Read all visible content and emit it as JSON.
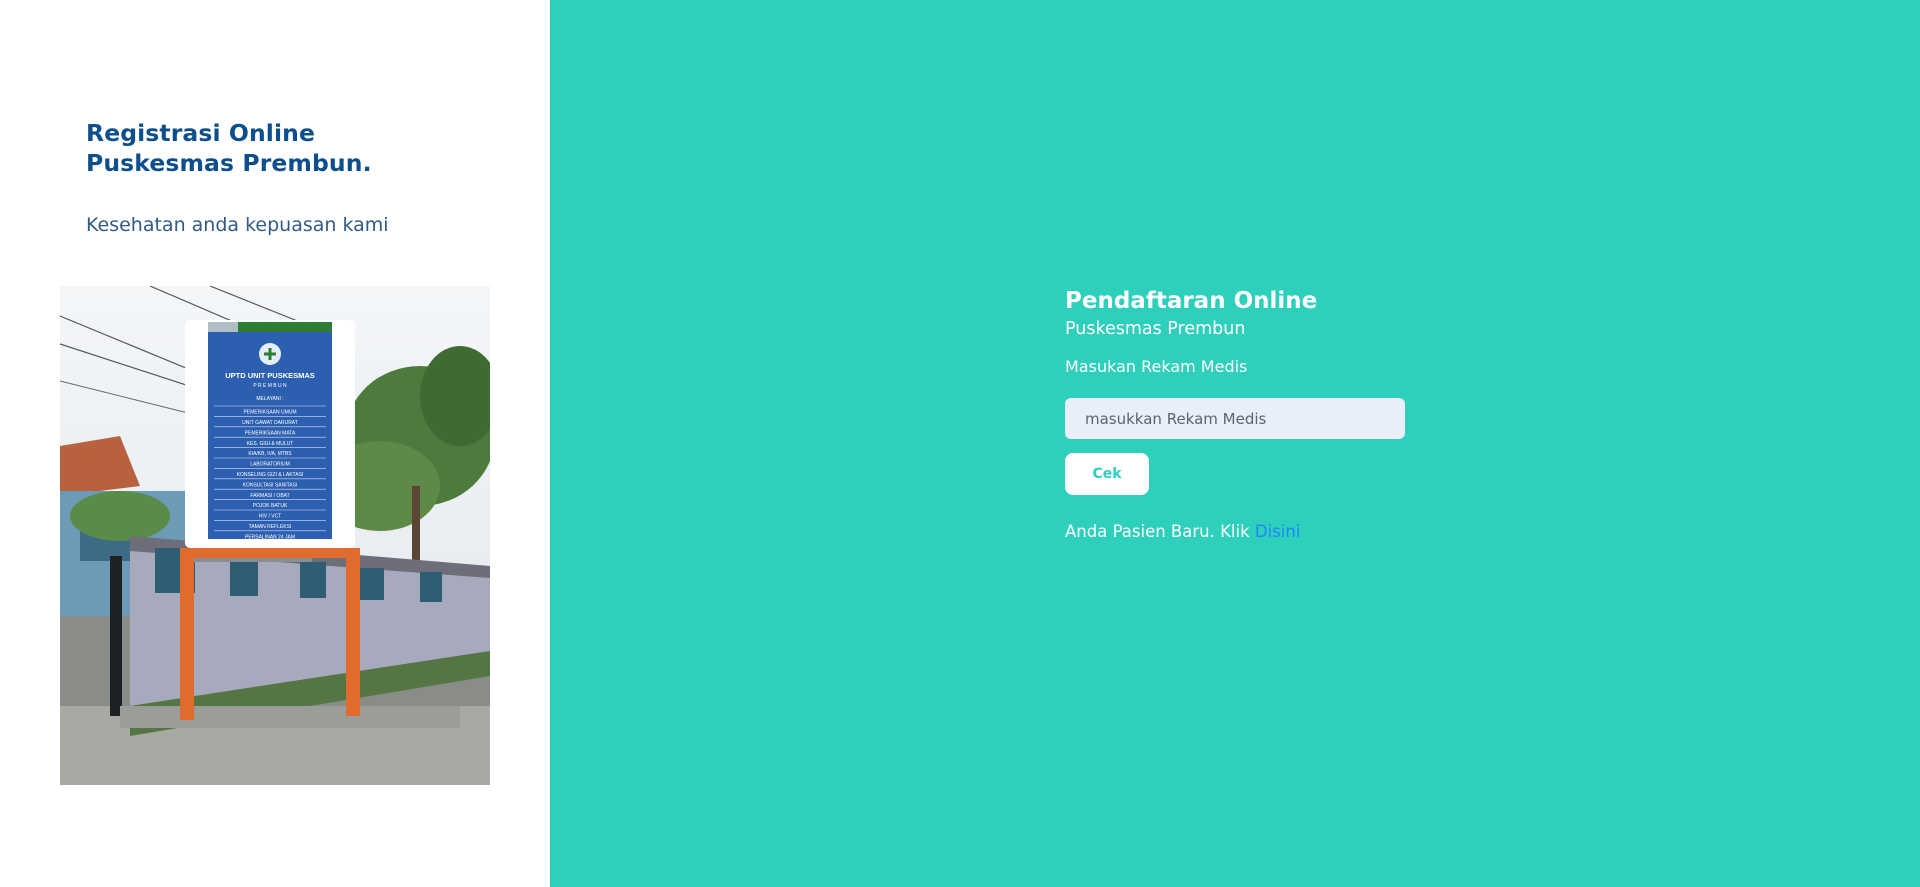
{
  "left_panel": {
    "title_line1": "Registrasi Online",
    "title_line2": "Puskesmas Prembun.",
    "tagline": "Kesehatan anda kepuasan kami",
    "photo": {
      "sign_header_line1": "UPTD UNIT PUSKESMAS",
      "sign_header_line2": "P R E M B U N",
      "sign_section": "MELAYANI :",
      "sign_services": [
        "PEMERIKSAAN UMUM",
        "UNIT GAWAT DARURAT",
        "PEMERIKSAAN MATA",
        "KES. GIGI & MULUT",
        "KIA/KB, IVA, MTBS",
        "LABORATORIUM",
        "KONSELING GIZI & LAKTASI",
        "KONSULTASI SANITASI",
        "FARMASI / OBAT",
        "POJOK BATUK",
        "HIV / VCT",
        "TAMAN REFLEKSI",
        "PERSALINAN 24 JAM"
      ]
    }
  },
  "form": {
    "title": "Pendaftaran Online",
    "subtitle": "Puskesmas Prembun",
    "field_label": "Masukan Rekam Medis",
    "input_placeholder": "masukkan Rekam Medis",
    "input_value": "",
    "submit_label": "Cek",
    "new_patient_text": "Anda Pasien Baru. Klik",
    "new_patient_link": "Disini"
  },
  "colors": {
    "panel_background": "#2ecfbb",
    "title_blue": "#0d4f8c",
    "link_blue": "#1e86ff",
    "input_background": "#e9eff8"
  }
}
